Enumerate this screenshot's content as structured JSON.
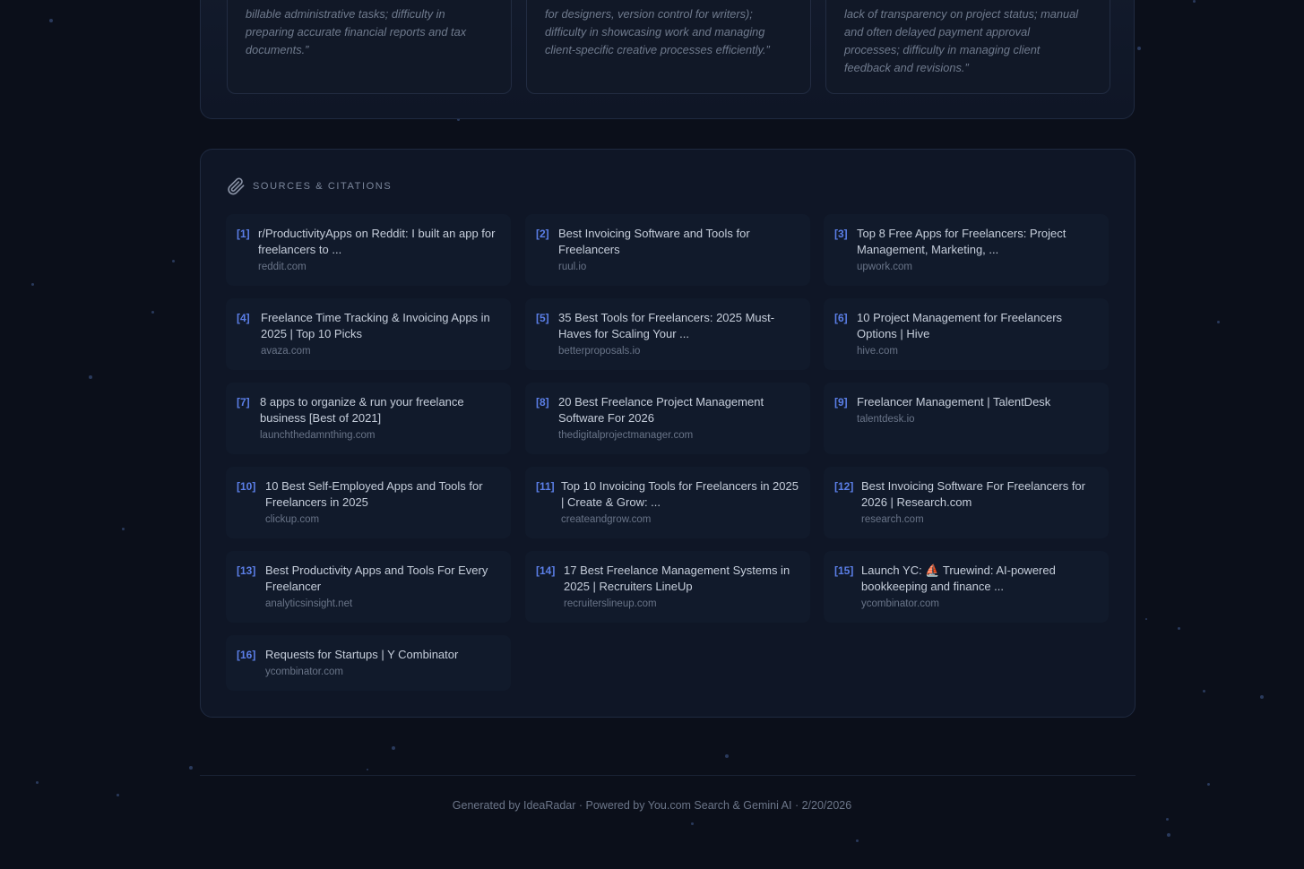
{
  "quotes": [
    {
      "text": "billable administrative tasks; difficulty in\npreparing accurate financial reports and tax\ndocuments.”"
    },
    {
      "text": "for designers, version control for writers);\ndifficulty in showcasing work and managing\nclient-specific creative processes efficiently.”"
    },
    {
      "text": "lack of transparency on project status; manual\nand often delayed payment approval\nprocesses; difficulty in managing client\nfeedback and revisions.”"
    }
  ],
  "sources": {
    "title": "SOURCES & CITATIONS",
    "icon": "paperclip-icon",
    "items": [
      {
        "num": "[1]",
        "title": "r/ProductivityApps on Reddit: I built an app for freelancers to ...",
        "domain": "reddit.com"
      },
      {
        "num": "[2]",
        "title": "Best Invoicing Software and Tools for Freelancers",
        "domain": "ruul.io"
      },
      {
        "num": "[3]",
        "title": "Top 8 Free Apps for Freelancers: Project Management, Marketing, ...",
        "domain": "upwork.com"
      },
      {
        "num": "[4]",
        "title": "Freelance Time Tracking & Invoicing Apps in 2025 | Top 10 Picks",
        "domain": "avaza.com"
      },
      {
        "num": "[5]",
        "title": "35 Best Tools for Freelancers: 2025 Must-Haves for Scaling Your ...",
        "domain": "betterproposals.io"
      },
      {
        "num": "[6]",
        "title": "10 Project Management for Freelancers Options | Hive",
        "domain": "hive.com"
      },
      {
        "num": "[7]",
        "title": "8 apps to organize & run your freelance business [Best of 2021]",
        "domain": "launchthedamnthing.com"
      },
      {
        "num": "[8]",
        "title": "20 Best Freelance Project Management Software For 2026",
        "domain": "thedigitalprojectmanager.com"
      },
      {
        "num": "[9]",
        "title": "Freelancer Management | TalentDesk",
        "domain": "talentdesk.io"
      },
      {
        "num": "[10]",
        "title": "10 Best Self-Employed Apps and Tools for Freelancers in 2025",
        "domain": "clickup.com"
      },
      {
        "num": "[11]",
        "title": "Top 10 Invoicing Tools for Freelancers in 2025 | Create & Grow: ...",
        "domain": "createandgrow.com"
      },
      {
        "num": "[12]",
        "title": "Best Invoicing Software For Freelancers for 2026 | Research.com",
        "domain": "research.com"
      },
      {
        "num": "[13]",
        "title": "Best Productivity Apps and Tools For Every Freelancer",
        "domain": "analyticsinsight.net"
      },
      {
        "num": "[14]",
        "title": "17 Best Freelance Management Systems in 2025 | Recruiters LineUp",
        "domain": "recruiterslineup.com"
      },
      {
        "num": "[15]",
        "title": "Launch YC: ⛵ Truewind: AI-powered bookkeeping and finance ...",
        "domain": "ycombinator.com"
      },
      {
        "num": "[16]",
        "title": "Requests for Startups | Y Combinator",
        "domain": "ycombinator.com"
      }
    ]
  },
  "footer": {
    "text": "Generated by IdeaRadar · Powered by You.com Search & Gemini AI · 2/20/2026"
  },
  "colors": {
    "background": "#0b0f1a",
    "panel": "#0f1626",
    "card": "#111a2b",
    "accent": "#5b7fe8",
    "text": "#c6cedb",
    "muted": "#697488"
  }
}
